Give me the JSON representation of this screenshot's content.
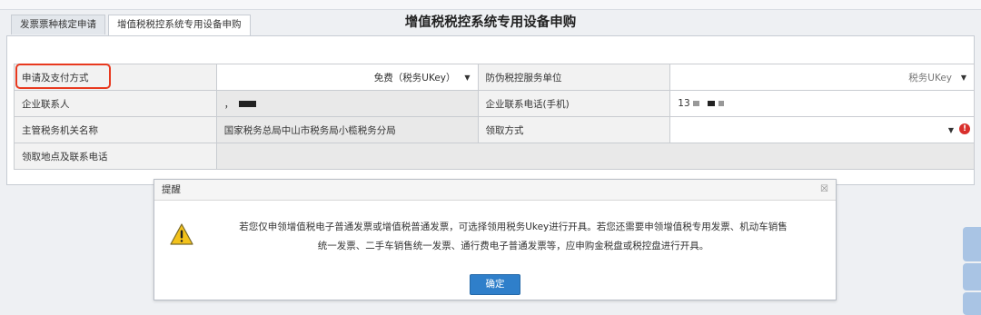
{
  "tabs": [
    {
      "label": "发票票种核定申请"
    },
    {
      "label": "增值税税控系统专用设备申购"
    }
  ],
  "form": {
    "title": "增值税税控系统专用设备申购",
    "rows": {
      "pay": {
        "label": "申请及支付方式",
        "value": "免费（税务UKey）",
        "label2": "防伪税控服务单位",
        "value2": "税务UKey"
      },
      "contact": {
        "label": "企业联系人",
        "value_prefix": "，",
        "label2": "企业联系电话(手机)",
        "value2_prefix": "13"
      },
      "authority": {
        "label": "主管税务机关名称",
        "value": "国家税务总局中山市税务局小榄税务分局",
        "label2": "领取方式",
        "value2": ""
      },
      "pickup": {
        "label": "领取地点及联系电话",
        "value": ""
      }
    }
  },
  "dialog": {
    "title": "提醒",
    "close": "☒",
    "line1": "若您仅申领增值税电子普通发票或增值税普通发票，可选择领用税务Ukey进行开具。若您还需要申领增值税专用发票、机动车销售",
    "line2": "统一发票、二手车销售统一发票、通行费电子普通发票等，应申购金税盘或税控盘进行开具。",
    "ok": "确定"
  },
  "icons": {
    "warning": "warning-icon",
    "error": "error-icon",
    "dropdown": "caret-down-icon"
  },
  "colors": {
    "highlight": "#e8391f",
    "primary_button": "#2f7fca",
    "error": "#d9302c"
  }
}
